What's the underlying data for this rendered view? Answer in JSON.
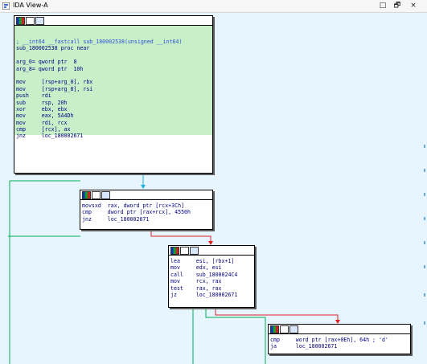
{
  "window": {
    "title": "IDA View-A",
    "restore_btn": "□",
    "float_btn": "🗗",
    "close_btn": "×"
  },
  "node1": {
    "lines": [
      "",
      "; __int64 __fastcall sub_180002538(unsigned __int64)",
      "sub_180002538 proc near",
      "",
      "arg_0= qword ptr  8",
      "arg_8= qword ptr  10h",
      "",
      "mov     [rsp+arg_0], rbx",
      "mov     [rsp+arg_8], rsi",
      "push    rdi",
      "sub     rsp, 20h",
      "xor     ebx, ebx",
      "mov     eax, 5A4Dh",
      "mov     rdi, rcx",
      "cmp     [rcx], ax",
      "jnz     loc_180002671"
    ]
  },
  "node2": {
    "lines": [
      "movsxd  rax, dword ptr [rcx+3Ch]",
      "cmp     dword ptr [rax+rcx], 4550h",
      "jnz     loc_180002671"
    ]
  },
  "node3": {
    "lines": [
      "lea     esi, [rbx+1]",
      "mov     edx, esi",
      "call    sub_1800024C4",
      "mov     rcx, rax",
      "test    rax, rax",
      "jz      loc_180002671"
    ]
  },
  "node4": {
    "lines": [
      "cmp     word ptr [rax+0Eh], 64h ; 'd'",
      "ja      loc_180002671"
    ]
  },
  "colors": {
    "background": "#e6f5ff",
    "highlight": "#c8f0c8",
    "edge_true": "#00b050",
    "edge_false": "#e02020",
    "edge_uncond": "#1ab0e0"
  }
}
